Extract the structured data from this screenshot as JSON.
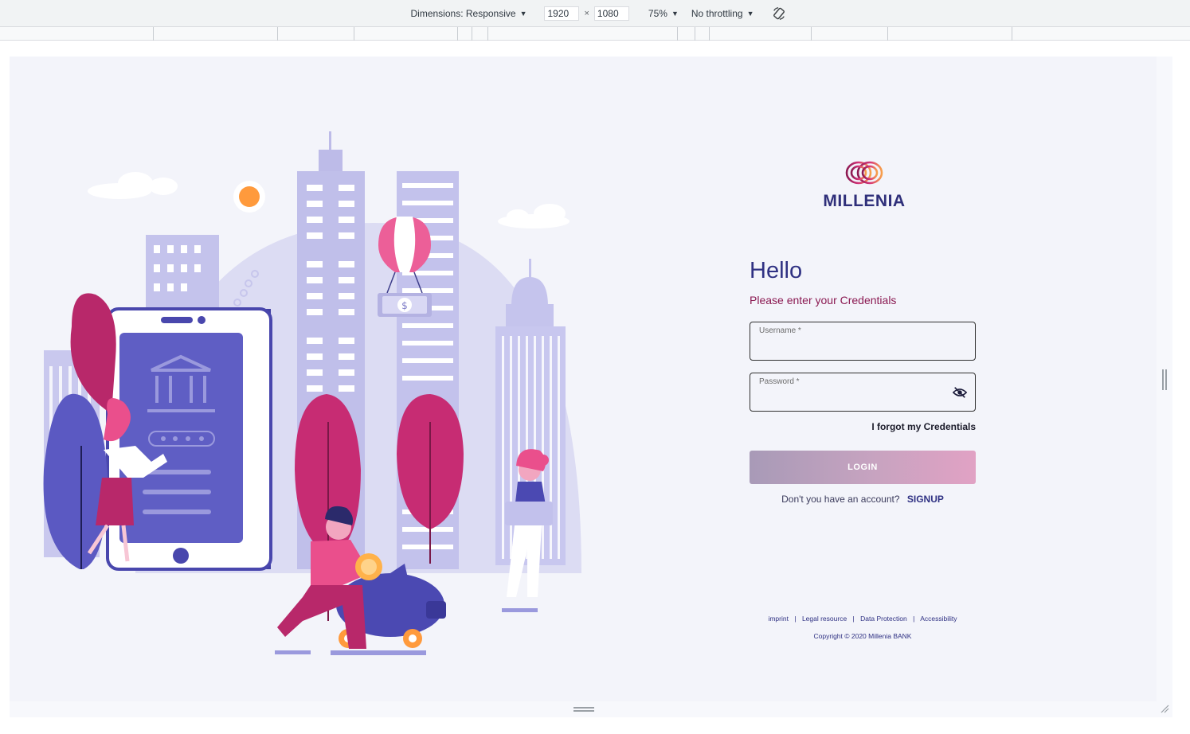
{
  "devtools": {
    "dimensions_label": "Dimensions: Responsive",
    "width_value": "1920",
    "times": "×",
    "height_value": "1080",
    "zoom": "75%",
    "throttling": "No throttling",
    "caret": "▼"
  },
  "brand": {
    "name": "MILLENIA",
    "primary_color": "#2f3183",
    "accent_color": "#8b1a52"
  },
  "login": {
    "heading": "Hello",
    "subtitle": "Please enter your Credentials",
    "username_label": "Username *",
    "username_value": "",
    "password_label": "Password *",
    "password_value": "",
    "forgot": "I forgot my Credentials",
    "login_button": "LOGIN",
    "no_account": "Don't you have an account?",
    "signup": "SIGNUP"
  },
  "footer": {
    "links": [
      "imprint",
      "Legal resource",
      "Data Protection",
      "Accessibility"
    ],
    "separator": "|",
    "copyright": "Copyright © 2020 Millenia BANK"
  }
}
